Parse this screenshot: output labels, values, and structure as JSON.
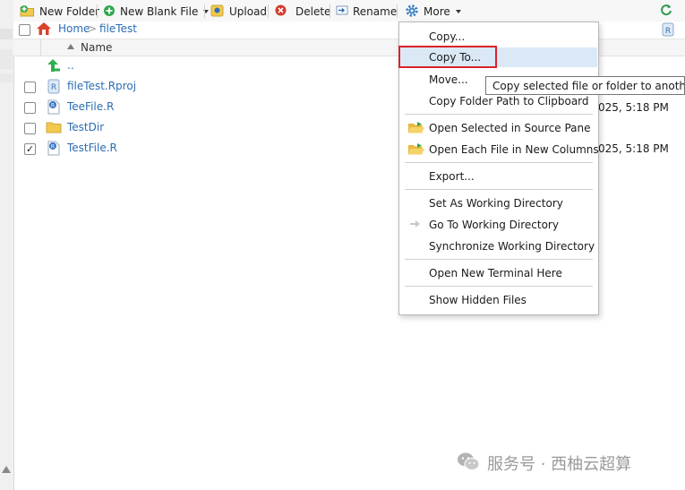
{
  "toolbar": {
    "new_folder": "New Folder",
    "new_blank_file": "New Blank File",
    "upload": "Upload",
    "delete": "Delete",
    "rename": "Rename",
    "more": "More"
  },
  "breadcrumb": {
    "home": "Home",
    "separator": ">",
    "folder": "fileTest"
  },
  "table": {
    "column_name": "Name",
    "rows": [
      {
        "name": "..",
        "checked": false,
        "modified": ""
      },
      {
        "name": "fileTest.Rproj",
        "checked": false,
        "modified": ""
      },
      {
        "name": "TeeFile.R",
        "checked": false,
        "modified": "025, 5:18 PM"
      },
      {
        "name": "TestDir",
        "checked": false,
        "modified": ""
      },
      {
        "name": "TestFile.R",
        "checked": true,
        "modified": "025, 5:18 PM"
      }
    ]
  },
  "more_menu": {
    "items": [
      "Copy...",
      "Copy To...",
      "Move...",
      "Copy Folder Path to Clipboard",
      "Open Selected in Source Pane",
      "Open Each File in New Columns",
      "Export...",
      "Set As Working Directory",
      "Go To Working Directory",
      "Synchronize Working Directory",
      "Open New Terminal Here",
      "Show Hidden Files"
    ],
    "highlighted_index": 1
  },
  "tooltip": {
    "text": "Copy selected file or folder to another folder"
  },
  "watermark": {
    "text": "服务号 · 西柚云超算"
  },
  "colors": {
    "link": "#2a6db5",
    "highlight_box": "#d8232a",
    "menu_highlight": "#dbe9f7"
  }
}
